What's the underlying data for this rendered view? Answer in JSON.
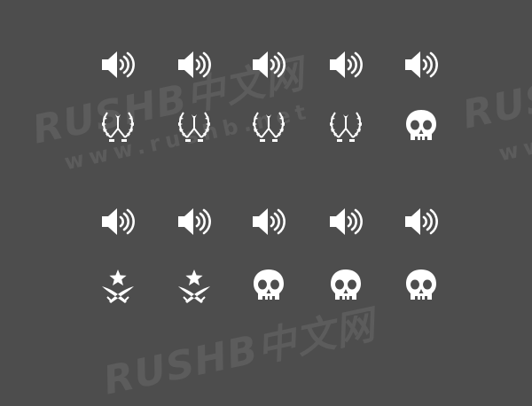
{
  "watermark": {
    "brand": "RUSHB中文网",
    "url": "www.rushb.net"
  },
  "icon_color": "#ffffff",
  "background": "#4d4d4d",
  "rows": [
    {
      "type": "sound",
      "items": [
        "speaker-icon",
        "speaker-icon",
        "speaker-icon",
        "speaker-icon",
        "speaker-icon"
      ]
    },
    {
      "type": "team",
      "items": [
        "ct-emblem-icon",
        "ct-emblem-icon",
        "ct-emblem-icon",
        "ct-emblem-icon",
        "skull-icon"
      ]
    },
    {
      "type": "sound",
      "items": [
        "speaker-icon",
        "speaker-icon",
        "speaker-icon",
        "speaker-icon",
        "speaker-icon"
      ]
    },
    {
      "type": "team",
      "items": [
        "t-emblem-icon",
        "t-emblem-icon",
        "skull-icon",
        "skull-icon",
        "skull-icon"
      ]
    }
  ]
}
